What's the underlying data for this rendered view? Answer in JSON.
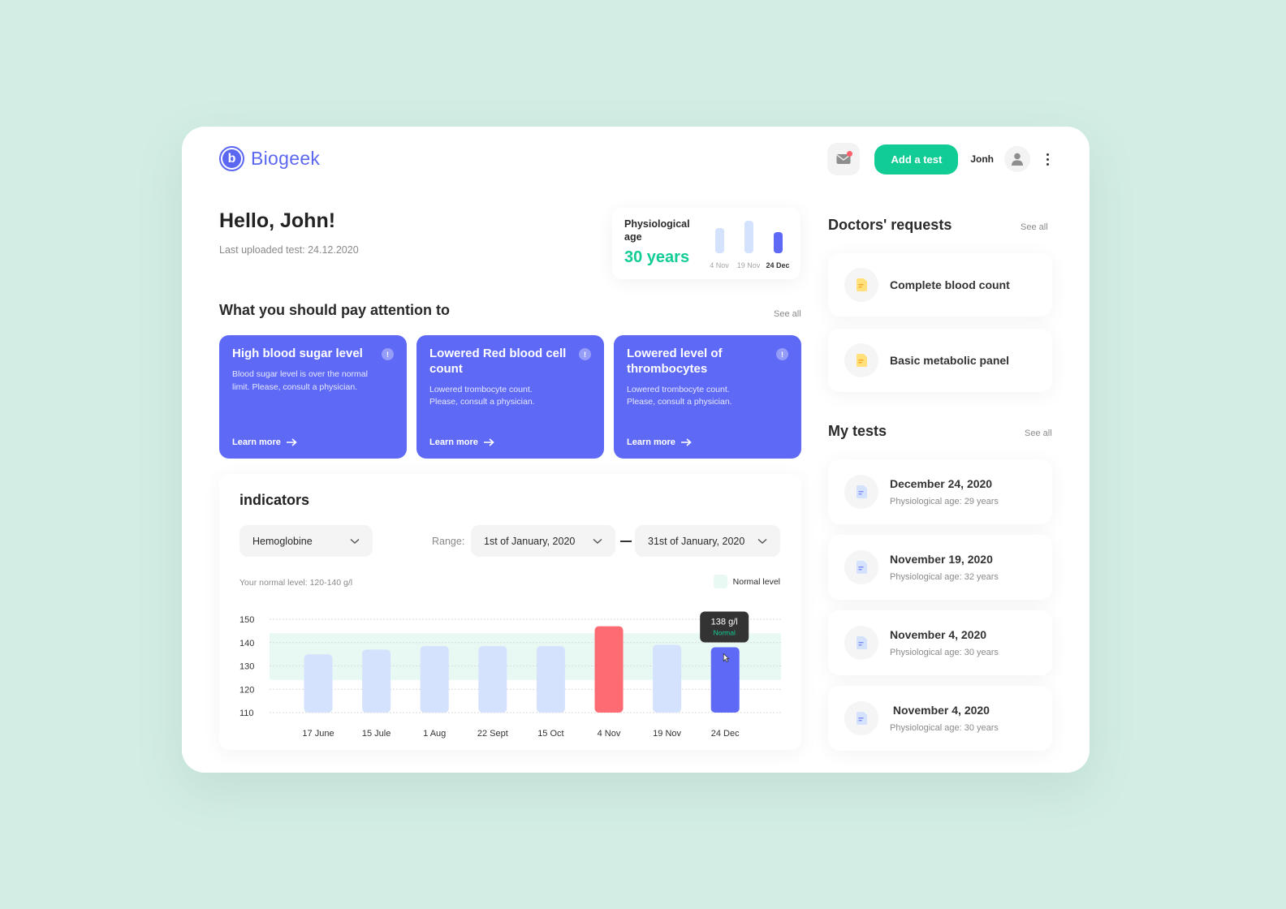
{
  "app": {
    "name": "Biogeek",
    "logo_letter": "b"
  },
  "header": {
    "add_test_label": "Add a test",
    "user_name": "Jonh",
    "has_unread_mail": true
  },
  "greeting": {
    "title": "Hello, John!",
    "last_uploaded": "Last uploaded test: 24.12.2020"
  },
  "physiological_age": {
    "label": "Physiological age",
    "value": "30 years",
    "bars": [
      {
        "label": "4 Nov",
        "value": 30,
        "active": false
      },
      {
        "label": "19 Nov",
        "value": 32,
        "active": false
      },
      {
        "label": "24 Dec",
        "value": 29,
        "active": true
      }
    ]
  },
  "attention": {
    "title": "What you should pay attention to",
    "see_all": "See all",
    "cards": [
      {
        "title": "High blood sugar level",
        "text": "Blood sugar level is over the normal limit. Please, consult a physician.",
        "link": "Learn more"
      },
      {
        "title": "Lowered Red blood cell count",
        "text": "Lowered trombocyte count. Please, consult a physician.",
        "link": "Learn more"
      },
      {
        "title": "Lowered level of thrombocytes",
        "text": "Lowered trombocyte count. Please, consult a physician.",
        "link": "Learn more"
      }
    ]
  },
  "indicators": {
    "title": "indicators",
    "indicator_select": "Hemoglobine",
    "range_label": "Range:",
    "range_from": "1st of January, 2020",
    "range_to": "31st of January, 2020",
    "normal_note": "Your normal level: 120-140 g/l",
    "legend_label": "Normal level",
    "tooltip": {
      "value": "138 g/l",
      "status": "Normal"
    }
  },
  "chart_data": {
    "type": "bar",
    "title": "indicators",
    "xlabel": "",
    "ylabel": "",
    "unit": "g/l",
    "categories": [
      "17 June",
      "15 Jule",
      "1 Aug",
      "22 Sept",
      "15 Oct",
      "4 Nov",
      "19 Nov",
      "24 Dec"
    ],
    "values": [
      135,
      137,
      138.5,
      138.5,
      138.5,
      147,
      139,
      138
    ],
    "status": [
      "normal",
      "normal",
      "normal",
      "normal",
      "normal",
      "high",
      "normal",
      "selected"
    ],
    "ylim": [
      110,
      150
    ],
    "yticks": [
      110,
      120,
      130,
      140,
      150
    ],
    "normal_range": [
      124,
      144
    ],
    "grid": true,
    "legend": "top-right",
    "colors": {
      "normal": "#d5e2fd",
      "high": "#ff6b72",
      "selected": "#5e69f5",
      "band": "#e7f9f2"
    }
  },
  "doctors_requests": {
    "title": "Doctors' requests",
    "see_all": "See all",
    "items": [
      {
        "name": "Complete blood count"
      },
      {
        "name": "Basic metabolic panel"
      }
    ]
  },
  "my_tests": {
    "title": "My tests",
    "see_all": "See all",
    "items": [
      {
        "date": "December 24, 2020",
        "sub": "Physiological age: 29 years"
      },
      {
        "date": "November 19, 2020",
        "sub": "Physiological age:  32 years"
      },
      {
        "date": "November 4, 2020",
        "sub": "Physiological age:  30 years"
      },
      {
        "date": " November 4, 2020",
        "sub": "Physiological age:  30 years"
      }
    ]
  },
  "colors": {
    "accent": "#5e69f5",
    "brand_green": "#12cc95",
    "alert_red": "#ff6b72",
    "background": "#d3ede4"
  }
}
